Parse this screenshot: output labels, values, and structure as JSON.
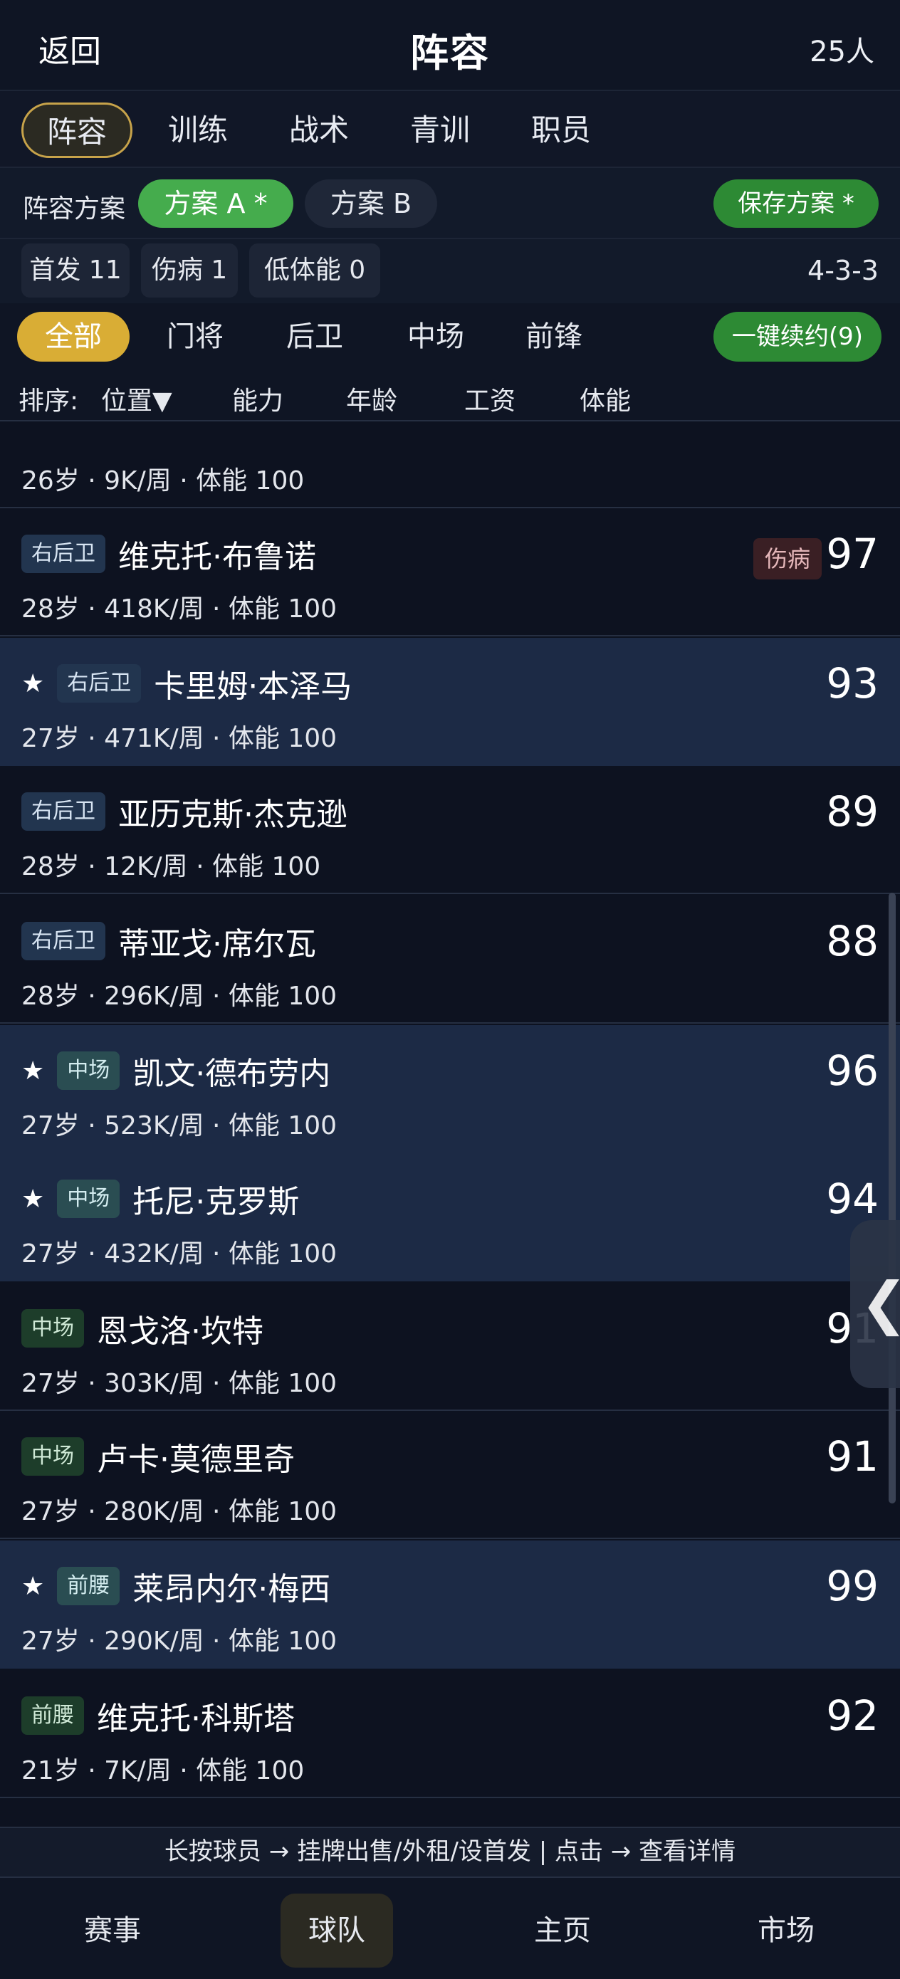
{
  "header": {
    "back_label": "返回",
    "title": "阵容",
    "player_count": "25人"
  },
  "tabs": [
    "阵容",
    "训练",
    "战术",
    "青训",
    "职员"
  ],
  "schemes": {
    "label": "阵容方案",
    "plan_a": "方案 A *",
    "plan_b": "方案 B",
    "save_label": "保存方案 *"
  },
  "stats": {
    "starters": "首发 11",
    "injured": "伤病 1",
    "low_stamina": "低体能 0",
    "formation": "4-3-3"
  },
  "filters": {
    "items": [
      "全部",
      "门将",
      "后卫",
      "中场",
      "前锋"
    ],
    "renew_label": "一键续约(9)"
  },
  "sort": {
    "label": "排序:",
    "options": [
      "位置▼",
      "能力",
      "年龄",
      "工资",
      "体能"
    ]
  },
  "players": [
    {
      "pos": "右后卫",
      "name": "维克托·布鲁诺",
      "meta": "28岁 · 418K/周 · 体能 100",
      "rating": "97",
      "star": false,
      "injury": "伤病"
    },
    {
      "pos": "右后卫",
      "name": "卡里姆·本泽马",
      "meta": "27岁 · 471K/周 · 体能 100",
      "rating": "93",
      "star": true
    },
    {
      "pos": "右后卫",
      "name": "亚历克斯·杰克逊",
      "meta": "28岁 · 12K/周 · 体能 100",
      "rating": "89",
      "star": false
    },
    {
      "pos": "右后卫",
      "name": "蒂亚戈·席尔瓦",
      "meta": "28岁 · 296K/周 · 体能 100",
      "rating": "88",
      "star": false
    },
    {
      "pos": "中场",
      "name": "凯文·德布劳内",
      "meta": "27岁 · 523K/周 · 体能 100",
      "rating": "96",
      "star": true
    },
    {
      "pos": "中场",
      "name": "托尼·克罗斯",
      "meta": "27岁 · 432K/周 · 体能 100",
      "rating": "94",
      "star": true
    },
    {
      "pos": "中场",
      "name": "恩戈洛·坎特",
      "meta": "27岁 · 303K/周 · 体能 100",
      "rating": "91",
      "star": false
    },
    {
      "pos": "中场",
      "name": "卢卡·莫德里奇",
      "meta": "27岁 · 280K/周 · 体能 100",
      "rating": "91",
      "star": false
    },
    {
      "pos": "前腰",
      "name": "莱昂内尔·梅西",
      "meta": "27岁 · 290K/周 · 体能 100",
      "rating": "99",
      "star": true
    },
    {
      "pos": "前腰",
      "name": "维克托·科斯塔",
      "meta": "21岁 · 7K/周 · 体能 100",
      "rating": "92",
      "star": false
    }
  ],
  "partial_top": {
    "meta": "26岁 · 9K/周 · 体能 100"
  },
  "hint": "长按球员 → 挂牌出售/外租/设首发 | 点击 → 查看详情",
  "nav": [
    "赛事",
    "球队",
    "主页",
    "市场"
  ],
  "icons": {
    "star": "★",
    "collapse": "❮"
  }
}
